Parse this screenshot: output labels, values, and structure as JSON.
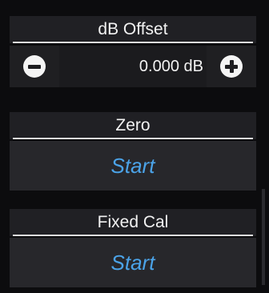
{
  "db_offset": {
    "header": "dB Offset",
    "value": "0.000 dB"
  },
  "zero": {
    "header": "Zero",
    "button_label": "Start"
  },
  "fixed_cal": {
    "header": "Fixed Cal",
    "button_label": "Start"
  },
  "colors": {
    "background": "#0c0c0e",
    "header_bg": "#202024",
    "button_bg": "#27272b",
    "accent_text": "#4ba3e8",
    "text": "#f2f2f2"
  },
  "icons": {
    "decrement": "minus-circle-icon",
    "increment": "plus-circle-icon"
  }
}
